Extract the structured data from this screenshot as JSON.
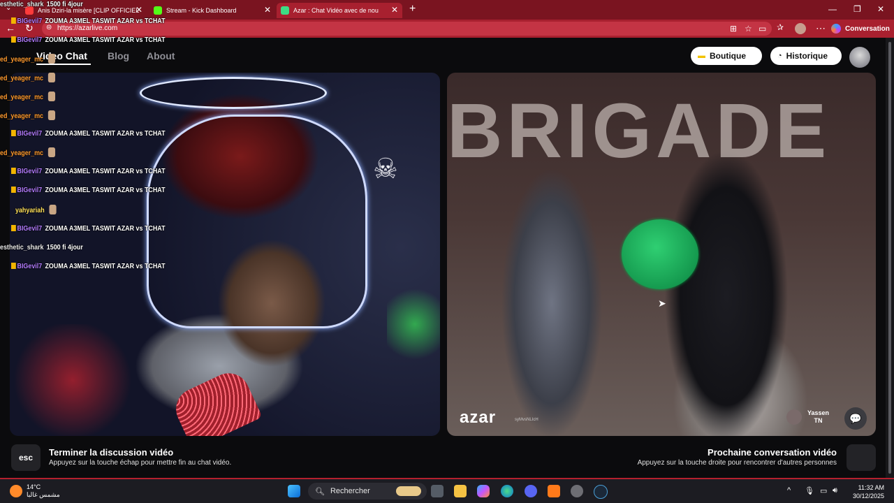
{
  "browser": {
    "tabs": [
      {
        "title": "Anis Dziri-la misère [CLIP OFFICIEL",
        "favicon_color": "#ff3b3b"
      },
      {
        "title": "Stream - Kick Dashboard",
        "favicon_color": "#53fc18"
      },
      {
        "title": "Azar : Chat Vidéo avec de nou",
        "favicon_color": "#3ddc84",
        "active": true
      }
    ],
    "url": "https://azarlive.com",
    "conversation_label": "Conversation",
    "theme_color": "#a8202f"
  },
  "site": {
    "nav": [
      {
        "label": "Video Chat",
        "active": true
      },
      {
        "label": "Blog"
      },
      {
        "label": "About"
      }
    ],
    "boutique_label": "Boutique",
    "historique_label": "Historique"
  },
  "stream_chat": [
    {
      "user": "esthetic_shark",
      "message": "1500 fi 4jour",
      "style": "u4"
    },
    {
      "user": "BIGevil7",
      "message": "ZOUMA A3MEL TASWIT AZAR vs TCHAT",
      "badge": true
    },
    {
      "user": "BIGevil7",
      "message": "ZOUMA A3MEL TASWIT AZAR vs TCHAT",
      "badge": true
    },
    {
      "user": "ed_yeager_mc",
      "message": "",
      "emote": true,
      "style": "u2"
    },
    {
      "user": "ed_yeager_mc",
      "message": "",
      "emote": true,
      "style": "u2"
    },
    {
      "user": "ed_yeager_mc",
      "message": "",
      "emote": true,
      "style": "u2"
    },
    {
      "user": "ed_yeager_mc",
      "message": "",
      "emote": true,
      "style": "u2"
    },
    {
      "user": "BIGevil7",
      "message": "ZOUMA A3MEL TASWIT AZAR vs TCHAT",
      "badge": true
    },
    {
      "user": "ed_yeager_mc",
      "message": "",
      "emote": true,
      "style": "u2"
    },
    {
      "user": "BIGevil7",
      "message": "ZOUMA A3MEL TASWIT AZAR vs TCHAT",
      "badge": true
    },
    {
      "user": "BIGevil7",
      "message": "ZOUMA A3MEL TASWIT AZAR vs TCHAT",
      "badge": true
    },
    {
      "user": "yahyariah",
      "message": "",
      "emote": true,
      "style": "u3"
    },
    {
      "user": "BIGevil7",
      "message": "ZOUMA A3MEL TASWIT AZAR vs TCHAT",
      "badge": true
    },
    {
      "user": "esthetic_shark",
      "message": "1500 fi 4jour",
      "style": "u4"
    },
    {
      "user": "BIGevil7",
      "message": "ZOUMA A3MEL TASWIT AZAR vs TCHAT",
      "badge": true
    }
  ],
  "video": {
    "logo": "azar",
    "logo_tag": "syMvsNLIcH",
    "partner_name": "Yassen",
    "partner_country": "TN",
    "background_text": "BRIGADE"
  },
  "controls": {
    "esc_key": "esc",
    "end_title": "Terminer la discussion vidéo",
    "end_sub": "Appuyez sur la touche échap pour mettre fin au chat vidéo.",
    "next_title": "Prochaine conversation vidéo",
    "next_sub": "Appuyez sur la touche droite pour rencontrer d'autres personnes"
  },
  "taskbar": {
    "temperature": "14°C",
    "weather_desc": "مشمس غالبا",
    "search_placeholder": "Rechercher",
    "time": "11:32 AM",
    "date": "30/12/2025"
  }
}
